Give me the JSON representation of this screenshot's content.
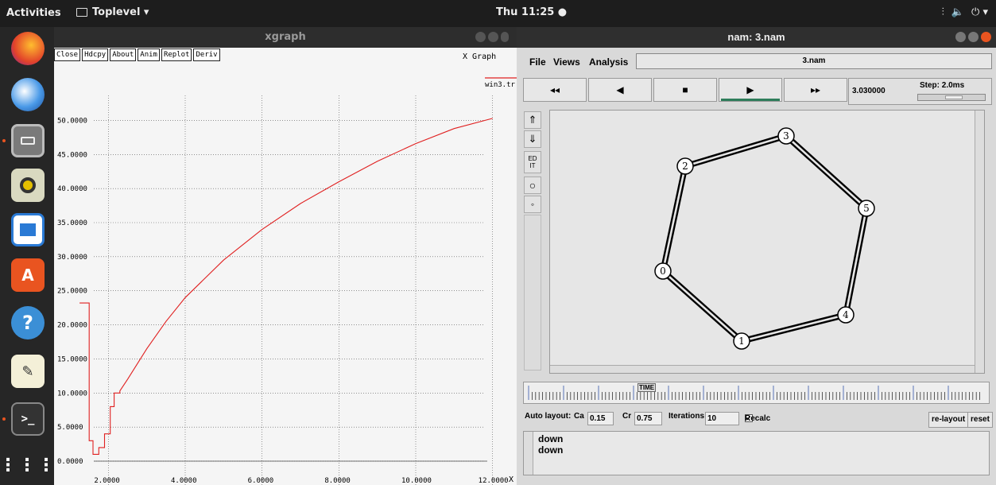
{
  "topbar": {
    "activities": "Activities",
    "app": "Toplevel ▾",
    "clock": "Thu 11:25 ●",
    "tray": [
      "⫶",
      "🔈",
      "⏻ ▾"
    ]
  },
  "dock": {
    "items": [
      "firefox-icon",
      "thunderbird-icon",
      "files-icon",
      "rhythmbox-icon",
      "writer-icon",
      "software-icon",
      "help-icon",
      "text-editor-icon",
      "terminal-icon",
      "apps-grid-icon"
    ]
  },
  "xgraph": {
    "title": "xgraph",
    "buttons": [
      "Close",
      "Hdcpy",
      "About",
      "Anim",
      "Replot",
      "Deriv"
    ],
    "graph_title": "X Graph",
    "legend": "win3.tr",
    "x_edge_label": "X"
  },
  "chart_data": {
    "type": "line",
    "title": "X Graph",
    "xlabel": "",
    "ylabel": "",
    "xlim": [
      0.7,
      13
    ],
    "ylim": [
      -0.5,
      56
    ],
    "x_ticks": [
      "2.0000",
      "4.0000",
      "6.0000",
      "8.0000",
      "10.0000",
      "12.0000"
    ],
    "x_tick_vals": [
      2,
      4,
      6,
      8,
      10,
      12
    ],
    "y_ticks": [
      "0.0000",
      "5.0000",
      "10.0000",
      "15.0000",
      "20.0000",
      "25.0000",
      "30.0000",
      "35.0000",
      "40.0000",
      "45.0000",
      "50.0000"
    ],
    "y_tick_vals": [
      0,
      5,
      10,
      15,
      20,
      25,
      30,
      35,
      40,
      45,
      50
    ],
    "grid": true,
    "legend_position": "top-right",
    "series": [
      {
        "name": "win3.tr",
        "color": "#e02020",
        "points": [
          [
            1.25,
            23.2
          ],
          [
            1.5,
            23.2
          ],
          [
            1.5,
            3
          ],
          [
            1.6,
            3
          ],
          [
            1.6,
            1
          ],
          [
            1.75,
            1
          ],
          [
            1.75,
            2
          ],
          [
            1.9,
            2
          ],
          [
            1.9,
            4
          ],
          [
            2.05,
            4
          ],
          [
            2.05,
            8
          ],
          [
            2.15,
            8
          ],
          [
            2.15,
            10
          ],
          [
            2.3,
            10
          ],
          [
            2.3,
            10.3
          ],
          [
            2.5,
            12
          ],
          [
            3,
            16.5
          ],
          [
            3.5,
            20.5
          ],
          [
            4,
            24
          ],
          [
            5,
            29.5
          ],
          [
            6,
            34
          ],
          [
            7,
            37.8
          ],
          [
            8,
            41
          ],
          [
            9,
            44
          ],
          [
            10,
            46.6
          ],
          [
            11,
            48.8
          ],
          [
            12,
            50.3
          ]
        ]
      }
    ]
  },
  "nam": {
    "title": "nam: 3.nam",
    "menu": [
      "File",
      "Views",
      "Analysis"
    ],
    "filename": "3.nam",
    "play_buttons": [
      "◂◂",
      "◀",
      "■",
      "▶",
      "▸▸"
    ],
    "time": "3.030000",
    "step": "Step: 2.0ms",
    "tools": [
      "⇑",
      "⇓",
      "ED IT",
      "○",
      "◦"
    ],
    "nodes": [
      {
        "label": "0"
      },
      {
        "label": "1"
      },
      {
        "label": "2"
      },
      {
        "label": "3"
      },
      {
        "label": "4"
      },
      {
        "label": "5"
      }
    ],
    "timeline_label": "TIME",
    "autolayout": {
      "label": "Auto layout:",
      "ca_label": "Ca",
      "ca": "0.15",
      "cr_label": "Cr",
      "cr": "0.75",
      "iter_label": "Iterations",
      "iterations": "10",
      "recalc": "Recalc",
      "relayout": "re-layout",
      "reset": "reset"
    },
    "log": [
      "down",
      "down"
    ]
  }
}
